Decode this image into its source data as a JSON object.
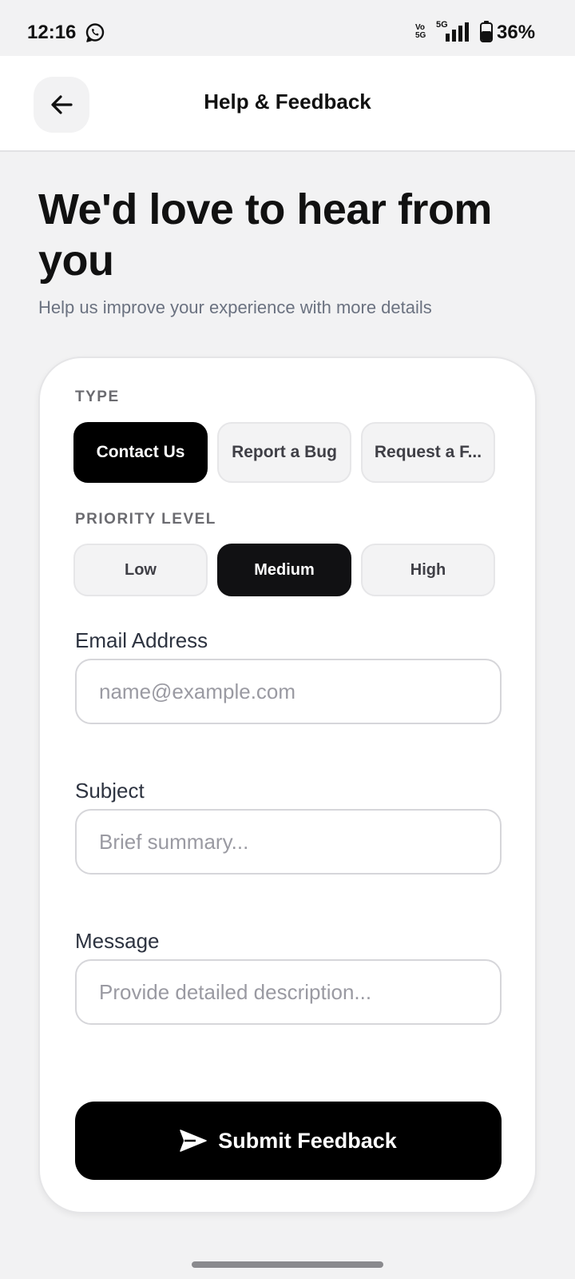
{
  "status_bar": {
    "time": "12:16",
    "volte": "Vo\n5G",
    "network": "5G",
    "battery": "36%"
  },
  "header": {
    "title": "Help & Feedback"
  },
  "hero": {
    "title": "We'd love to hear from you",
    "subtitle": "Help us improve your experience with more details"
  },
  "form": {
    "type_label": "TYPE",
    "types": [
      {
        "label": "Contact Us",
        "selected": true
      },
      {
        "label": "Report a Bug",
        "selected": false
      },
      {
        "label": "Request a F...",
        "selected": false
      }
    ],
    "priority_label": "PRIORITY LEVEL",
    "priorities": [
      {
        "label": "Low",
        "selected": false
      },
      {
        "label": "Medium",
        "selected": true
      },
      {
        "label": "High",
        "selected": false
      }
    ],
    "email": {
      "label": "Email Address",
      "placeholder": "name@example.com",
      "value": ""
    },
    "subject": {
      "label": "Subject",
      "placeholder": "Brief summary...",
      "value": ""
    },
    "message": {
      "label": "Message",
      "placeholder": "Provide detailed description...",
      "value": ""
    },
    "submit_label": "Submit Feedback"
  },
  "icons": {
    "whatsapp": "whatsapp-icon",
    "signal": "signal-icon",
    "battery": "battery-icon",
    "back": "arrow-left-icon",
    "send": "send-icon"
  },
  "colors": {
    "background": "#f2f2f3",
    "accent": "#000000",
    "selected_priority": "#111113",
    "muted_text": "#6b7280"
  }
}
